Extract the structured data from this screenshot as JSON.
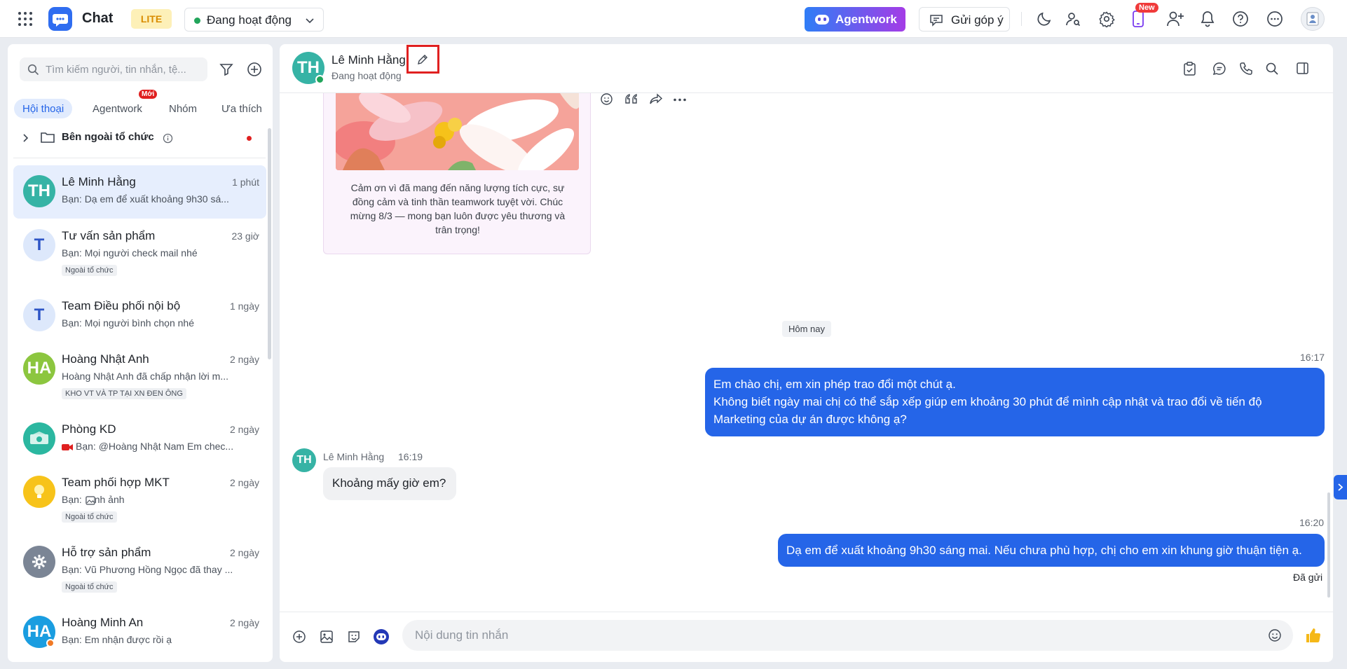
{
  "header": {
    "app_title": "Chat",
    "plan_badge": "LITE",
    "status_label": "Đang hoạt động",
    "agentwork_button": "Agentwork",
    "feedback_button": "Gửi góp ý",
    "new_badge": "New"
  },
  "sidebar": {
    "search_placeholder": "Tìm kiếm người, tin nhắn, tệ...",
    "tabs": [
      {
        "label": "Hội thoại",
        "active": true
      },
      {
        "label": "Agentwork",
        "badge": "Mới"
      },
      {
        "label": "Nhóm"
      },
      {
        "label": "Ưa thích"
      }
    ],
    "folder_label": "Bên ngoài tổ chức",
    "conversations": [
      {
        "initials": "TH",
        "name": "Lê Minh Hằng",
        "time": "1 phút",
        "preview": "Bạn: Dạ em để xuất khoảng 9h30 sá...",
        "color": "#36b3a5",
        "selected": true
      },
      {
        "initials": "T",
        "name": "Tư vấn sản phẩm",
        "time": "23 giờ",
        "preview": "Bạn: Mọi người check mail nhé",
        "tag": "Ngoài tổ chức",
        "color": "#dde8fb"
      },
      {
        "initials": "T",
        "name": "Team Điều phối nội bộ",
        "time": "1 ngày",
        "preview": "Bạn: Mọi người bình chọn nhé",
        "color": "#dde8fb"
      },
      {
        "initials": "HA",
        "name": "Hoàng Nhật Anh",
        "time": "2 ngày",
        "preview": "Hoàng Nhật Anh đã chấp nhận lời m...",
        "tag": "KHO VT VÀ TP TẠI XN ĐEN ÔNG",
        "color": "#8cc63f"
      },
      {
        "initials": "",
        "name": "Phòng KD",
        "time": "2 ngày",
        "preview": "Bạn: @Hoàng Nhật Nam Em chec...",
        "color": "#2bb7a0"
      },
      {
        "initials": "",
        "name": "Team phối hợp MKT",
        "time": "2 ngày",
        "preview": "Bạn: Hình ảnh",
        "tag": "Ngoài tổ chức",
        "color": "#f7c31a"
      },
      {
        "initials": "",
        "name": "Hỗ trợ sản phẩm",
        "time": "2 ngày",
        "preview": "Bạn: Vũ Phương Hồng Ngọc đã thay ...",
        "tag": "Ngoài tổ chức",
        "color": "#7b8595"
      },
      {
        "initials": "HA",
        "name": "Hoàng Minh An",
        "time": "2 ngày",
        "preview": "Bạn: Em nhận được rồi ạ",
        "color": "#1a9de0"
      }
    ]
  },
  "chat": {
    "contact_initials": "TH",
    "contact_name": "Lê Minh Hằng",
    "contact_status": "Đang hoạt động",
    "card_text": "Cảm ơn vì đã mang đến năng lượng tích cực, sự đồng cảm và tinh thần teamwork tuyệt vời. Chúc mừng 8/3 — mong bạn luôn được yêu thương và trân trọng!",
    "date_divider": "Hôm nay",
    "messages": [
      {
        "time": "16:17",
        "lines": [
          "Em chào chị, em xin phép trao đổi một chút ạ.",
          "Không biết ngày mai chị có thể sắp xếp giúp em khoảng 30 phút để mình cập nhật và trao đổi về tiến độ",
          "Marketing của dự án được không ạ?"
        ]
      },
      {
        "sender": "Lê Minh Hằng",
        "time": "16:19",
        "text": "Khoảng mấy giờ em?"
      },
      {
        "time": "16:20",
        "text": "Dạ em để xuất khoảng 9h30 sáng mai. Nếu chưa phù hợp, chị cho em xin khung giờ thuận tiện ạ.",
        "status": "Đã gửi"
      }
    ],
    "composer_placeholder": "Nội dung tin nhắn"
  },
  "colors": {
    "accent": "#2565e8",
    "online": "#22a55b",
    "highlight": "#e02020"
  }
}
